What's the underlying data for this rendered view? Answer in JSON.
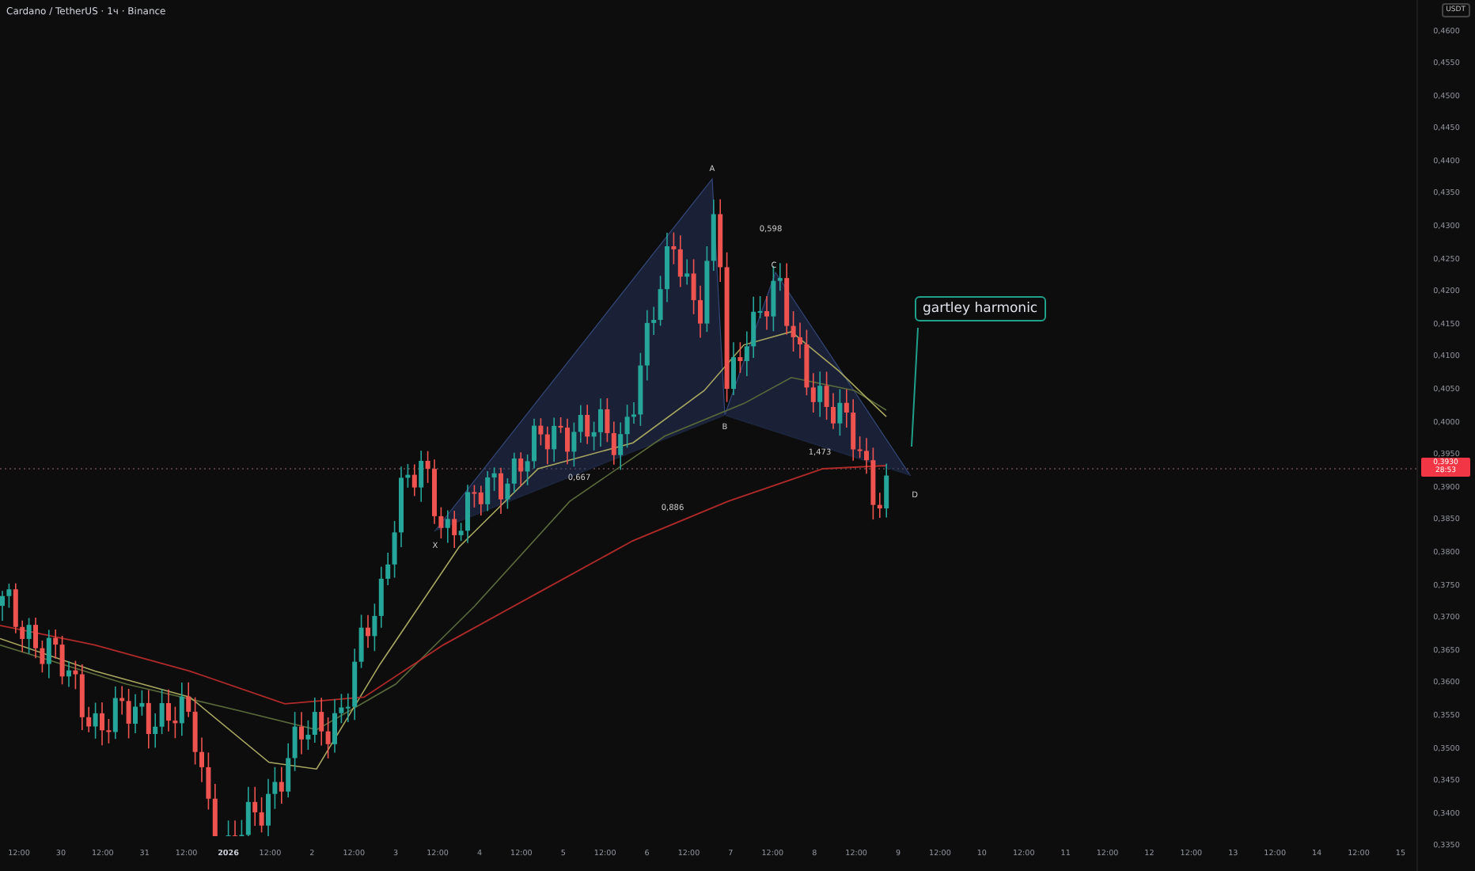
{
  "symbol_title": "Cardano / TetherUS · 1ч · Binance",
  "currency_badge": "USDT",
  "price_axis": [
    "0,4600",
    "0,4550",
    "0,4500",
    "0,4450",
    "0,4400",
    "0,4350",
    "0,4300",
    "0,4250",
    "0,4200",
    "0,4150",
    "0,4100",
    "0,4050",
    "0,4000",
    "0,3950",
    "0,3900",
    "0,3850",
    "0,3800",
    "0,3750",
    "0,3700",
    "0,3650",
    "0,3600",
    "0,3550",
    "0,3500",
    "0,3450",
    "0,3400",
    "0,3350"
  ],
  "current_price": {
    "value": "0,3930",
    "countdown": "28:53"
  },
  "time_axis": [
    "12:00",
    "30",
    "12:00",
    "31",
    "12:00",
    "2026",
    "12:00",
    "2",
    "12:00",
    "3",
    "12:00",
    "4",
    "12:00",
    "5",
    "12:00",
    "6",
    "12:00",
    "7",
    "12:00",
    "8",
    "12:00",
    "9",
    "12:00",
    "10",
    "12:00",
    "11",
    "12:00",
    "12",
    "12:00",
    "13",
    "12:00",
    "14",
    "12:00",
    "15"
  ],
  "pattern": {
    "points": [
      "X",
      "A",
      "B",
      "C",
      "D"
    ],
    "ratios": [
      "0,598",
      "0,667",
      "1,473",
      "0,886"
    ]
  },
  "annotation": "gartley harmonic"
}
